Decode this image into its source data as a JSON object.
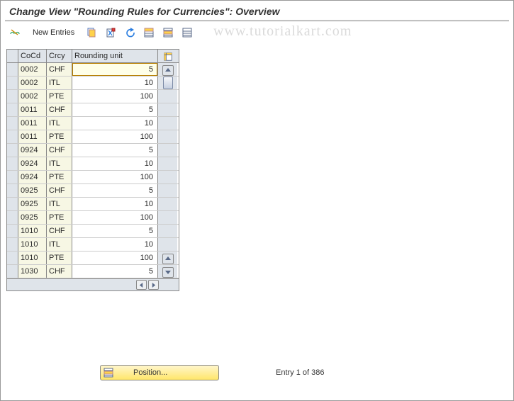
{
  "title": "Change View \"Rounding Rules for Currencies\": Overview",
  "watermark": "www.tutorialkart.com",
  "toolbar": {
    "change": "change-icon",
    "new_entries": "New Entries",
    "copy": "copy-icon",
    "delete": "delete-icon",
    "undo": "undo-icon",
    "select_all": "select-all-icon",
    "select_block": "select-block-icon",
    "deselect": "deselect-icon"
  },
  "table": {
    "headers": {
      "cocd": "CoCd",
      "crcy": "Crcy",
      "unit": "Rounding unit"
    },
    "rows": [
      {
        "cocd": "0002",
        "crcy": "CHF",
        "unit": "5"
      },
      {
        "cocd": "0002",
        "crcy": "ITL",
        "unit": "10"
      },
      {
        "cocd": "0002",
        "crcy": "PTE",
        "unit": "100"
      },
      {
        "cocd": "0011",
        "crcy": "CHF",
        "unit": "5"
      },
      {
        "cocd": "0011",
        "crcy": "ITL",
        "unit": "10"
      },
      {
        "cocd": "0011",
        "crcy": "PTE",
        "unit": "100"
      },
      {
        "cocd": "0924",
        "crcy": "CHF",
        "unit": "5"
      },
      {
        "cocd": "0924",
        "crcy": "ITL",
        "unit": "10"
      },
      {
        "cocd": "0924",
        "crcy": "PTE",
        "unit": "100"
      },
      {
        "cocd": "0925",
        "crcy": "CHF",
        "unit": "5"
      },
      {
        "cocd": "0925",
        "crcy": "ITL",
        "unit": "10"
      },
      {
        "cocd": "0925",
        "crcy": "PTE",
        "unit": "100"
      },
      {
        "cocd": "1010",
        "crcy": "CHF",
        "unit": "5"
      },
      {
        "cocd": "1010",
        "crcy": "ITL",
        "unit": "10"
      },
      {
        "cocd": "1010",
        "crcy": "PTE",
        "unit": "100"
      },
      {
        "cocd": "1030",
        "crcy": "CHF",
        "unit": "5"
      }
    ]
  },
  "footer": {
    "position_label": "Position...",
    "entry_text": "Entry 1 of 386"
  }
}
